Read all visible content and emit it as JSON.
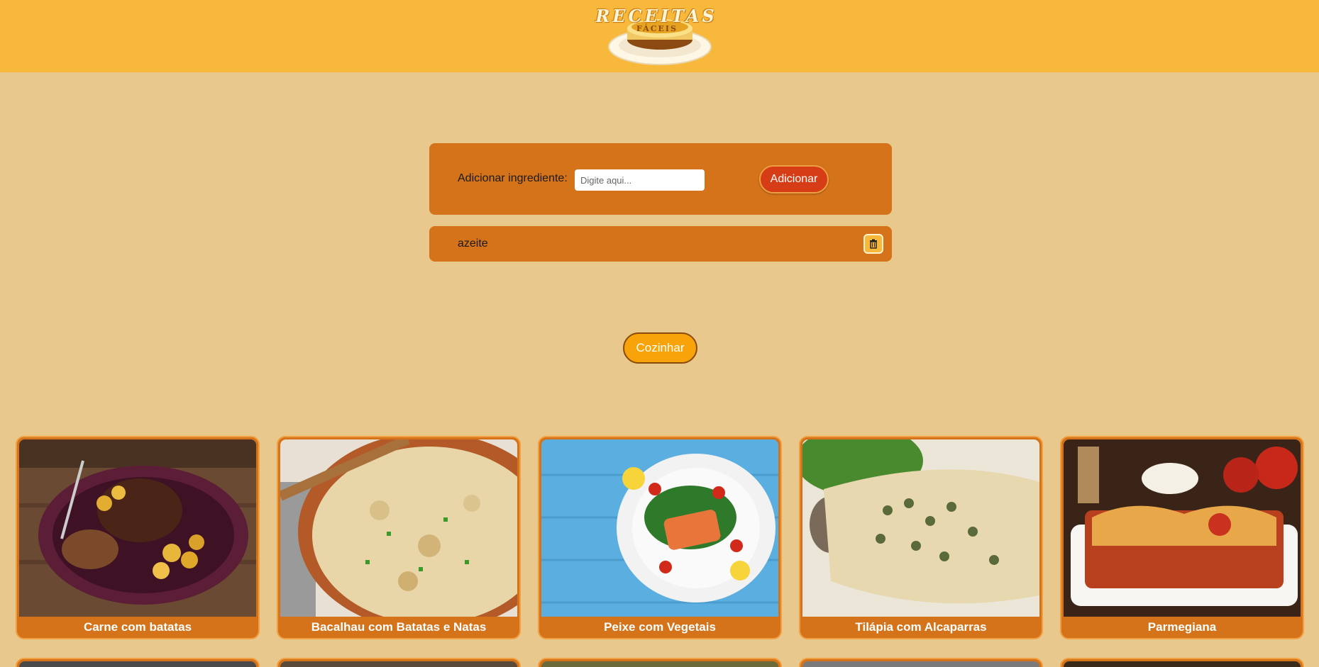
{
  "header": {
    "logo_title": "RECEITAS",
    "logo_subtitle": "FÁCEIS",
    "brand_color": "#f8b83c"
  },
  "ingredient_form": {
    "label": "Adicionar ingrediente:",
    "input_value": "",
    "input_placeholder": "Digite aqui...",
    "add_label": "Adicionar"
  },
  "ingredients": [
    {
      "name": "azeite",
      "delete_icon": "trash-icon"
    }
  ],
  "cook_label": "Cozinhar",
  "recipes": [
    {
      "title": "Carne com batatas",
      "image_icon": "steak-potatoes-photo"
    },
    {
      "title": "Bacalhau com Batatas e Natas",
      "image_icon": "cod-casserole-photo"
    },
    {
      "title": "Peixe com Vegetais",
      "image_icon": "salmon-salad-photo"
    },
    {
      "title": "Tilápia com Alcaparras",
      "image_icon": "tilapia-capers-photo"
    },
    {
      "title": "Parmegiana",
      "image_icon": "parmigiana-photo"
    }
  ],
  "colors": {
    "page_bg": "#e8c88c",
    "panel": "#d4731a",
    "add_button": "#d63c16",
    "cook_button": "#f8a30a"
  }
}
